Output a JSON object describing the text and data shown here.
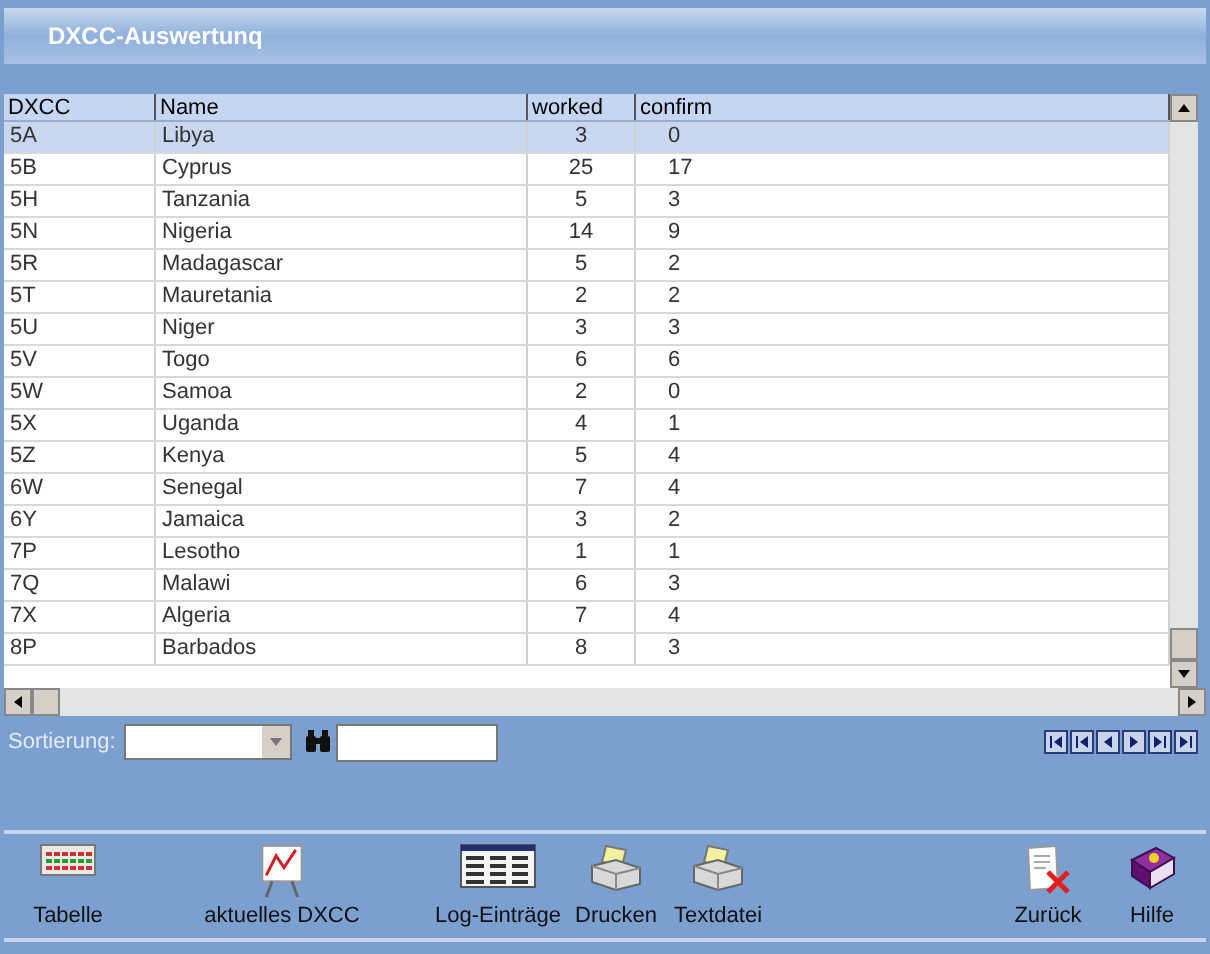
{
  "window": {
    "title": "DXCC-Auswertunq"
  },
  "table": {
    "columns": [
      "DXCC",
      "Name",
      "worked",
      "confirm"
    ],
    "rows": [
      {
        "cells": [
          "5A",
          "Libya",
          "3",
          "0"
        ],
        "selected": true
      },
      {
        "cells": [
          "5B",
          "Cyprus",
          "25",
          "17"
        ],
        "selected": false
      },
      {
        "cells": [
          "5H",
          "Tanzania",
          "5",
          "3"
        ],
        "selected": false
      },
      {
        "cells": [
          "5N",
          "Nigeria",
          "14",
          "9"
        ],
        "selected": false
      },
      {
        "cells": [
          "5R",
          "Madagascar",
          "5",
          "2"
        ],
        "selected": false
      },
      {
        "cells": [
          "5T",
          "Mauretania",
          "2",
          "2"
        ],
        "selected": false
      },
      {
        "cells": [
          "5U",
          "Niger",
          "3",
          "3"
        ],
        "selected": false
      },
      {
        "cells": [
          "5V",
          "Togo",
          "6",
          "6"
        ],
        "selected": false
      },
      {
        "cells": [
          "5W",
          "Samoa",
          "2",
          "0"
        ],
        "selected": false
      },
      {
        "cells": [
          "5X",
          "Uganda",
          "4",
          "1"
        ],
        "selected": false
      },
      {
        "cells": [
          "5Z",
          "Kenya",
          "5",
          "4"
        ],
        "selected": false
      },
      {
        "cells": [
          "6W",
          "Senegal",
          "7",
          "4"
        ],
        "selected": false
      },
      {
        "cells": [
          "6Y",
          "Jamaica",
          "3",
          "2"
        ],
        "selected": false
      },
      {
        "cells": [
          "7P",
          "Lesotho",
          "1",
          "1"
        ],
        "selected": false
      },
      {
        "cells": [
          "7Q",
          "Malawi",
          "6",
          "3"
        ],
        "selected": false
      },
      {
        "cells": [
          "7X",
          "Algeria",
          "7",
          "4"
        ],
        "selected": false
      },
      {
        "cells": [
          "8P",
          "Barbados",
          "8",
          "3"
        ],
        "selected": false
      }
    ]
  },
  "sort": {
    "label": "Sortierung:"
  },
  "toolbar": [
    {
      "label": "Tabelle",
      "kind": "table"
    },
    {
      "label": "aktuelles DXCC",
      "kind": "chart"
    },
    {
      "label": "Log-Einträge",
      "kind": "log"
    },
    {
      "label": "Drucken",
      "kind": "printer"
    },
    {
      "label": "Textdatei",
      "kind": "printer"
    },
    {
      "label": "Zurück",
      "kind": "delete"
    },
    {
      "label": "Hilfe",
      "kind": "book"
    }
  ]
}
